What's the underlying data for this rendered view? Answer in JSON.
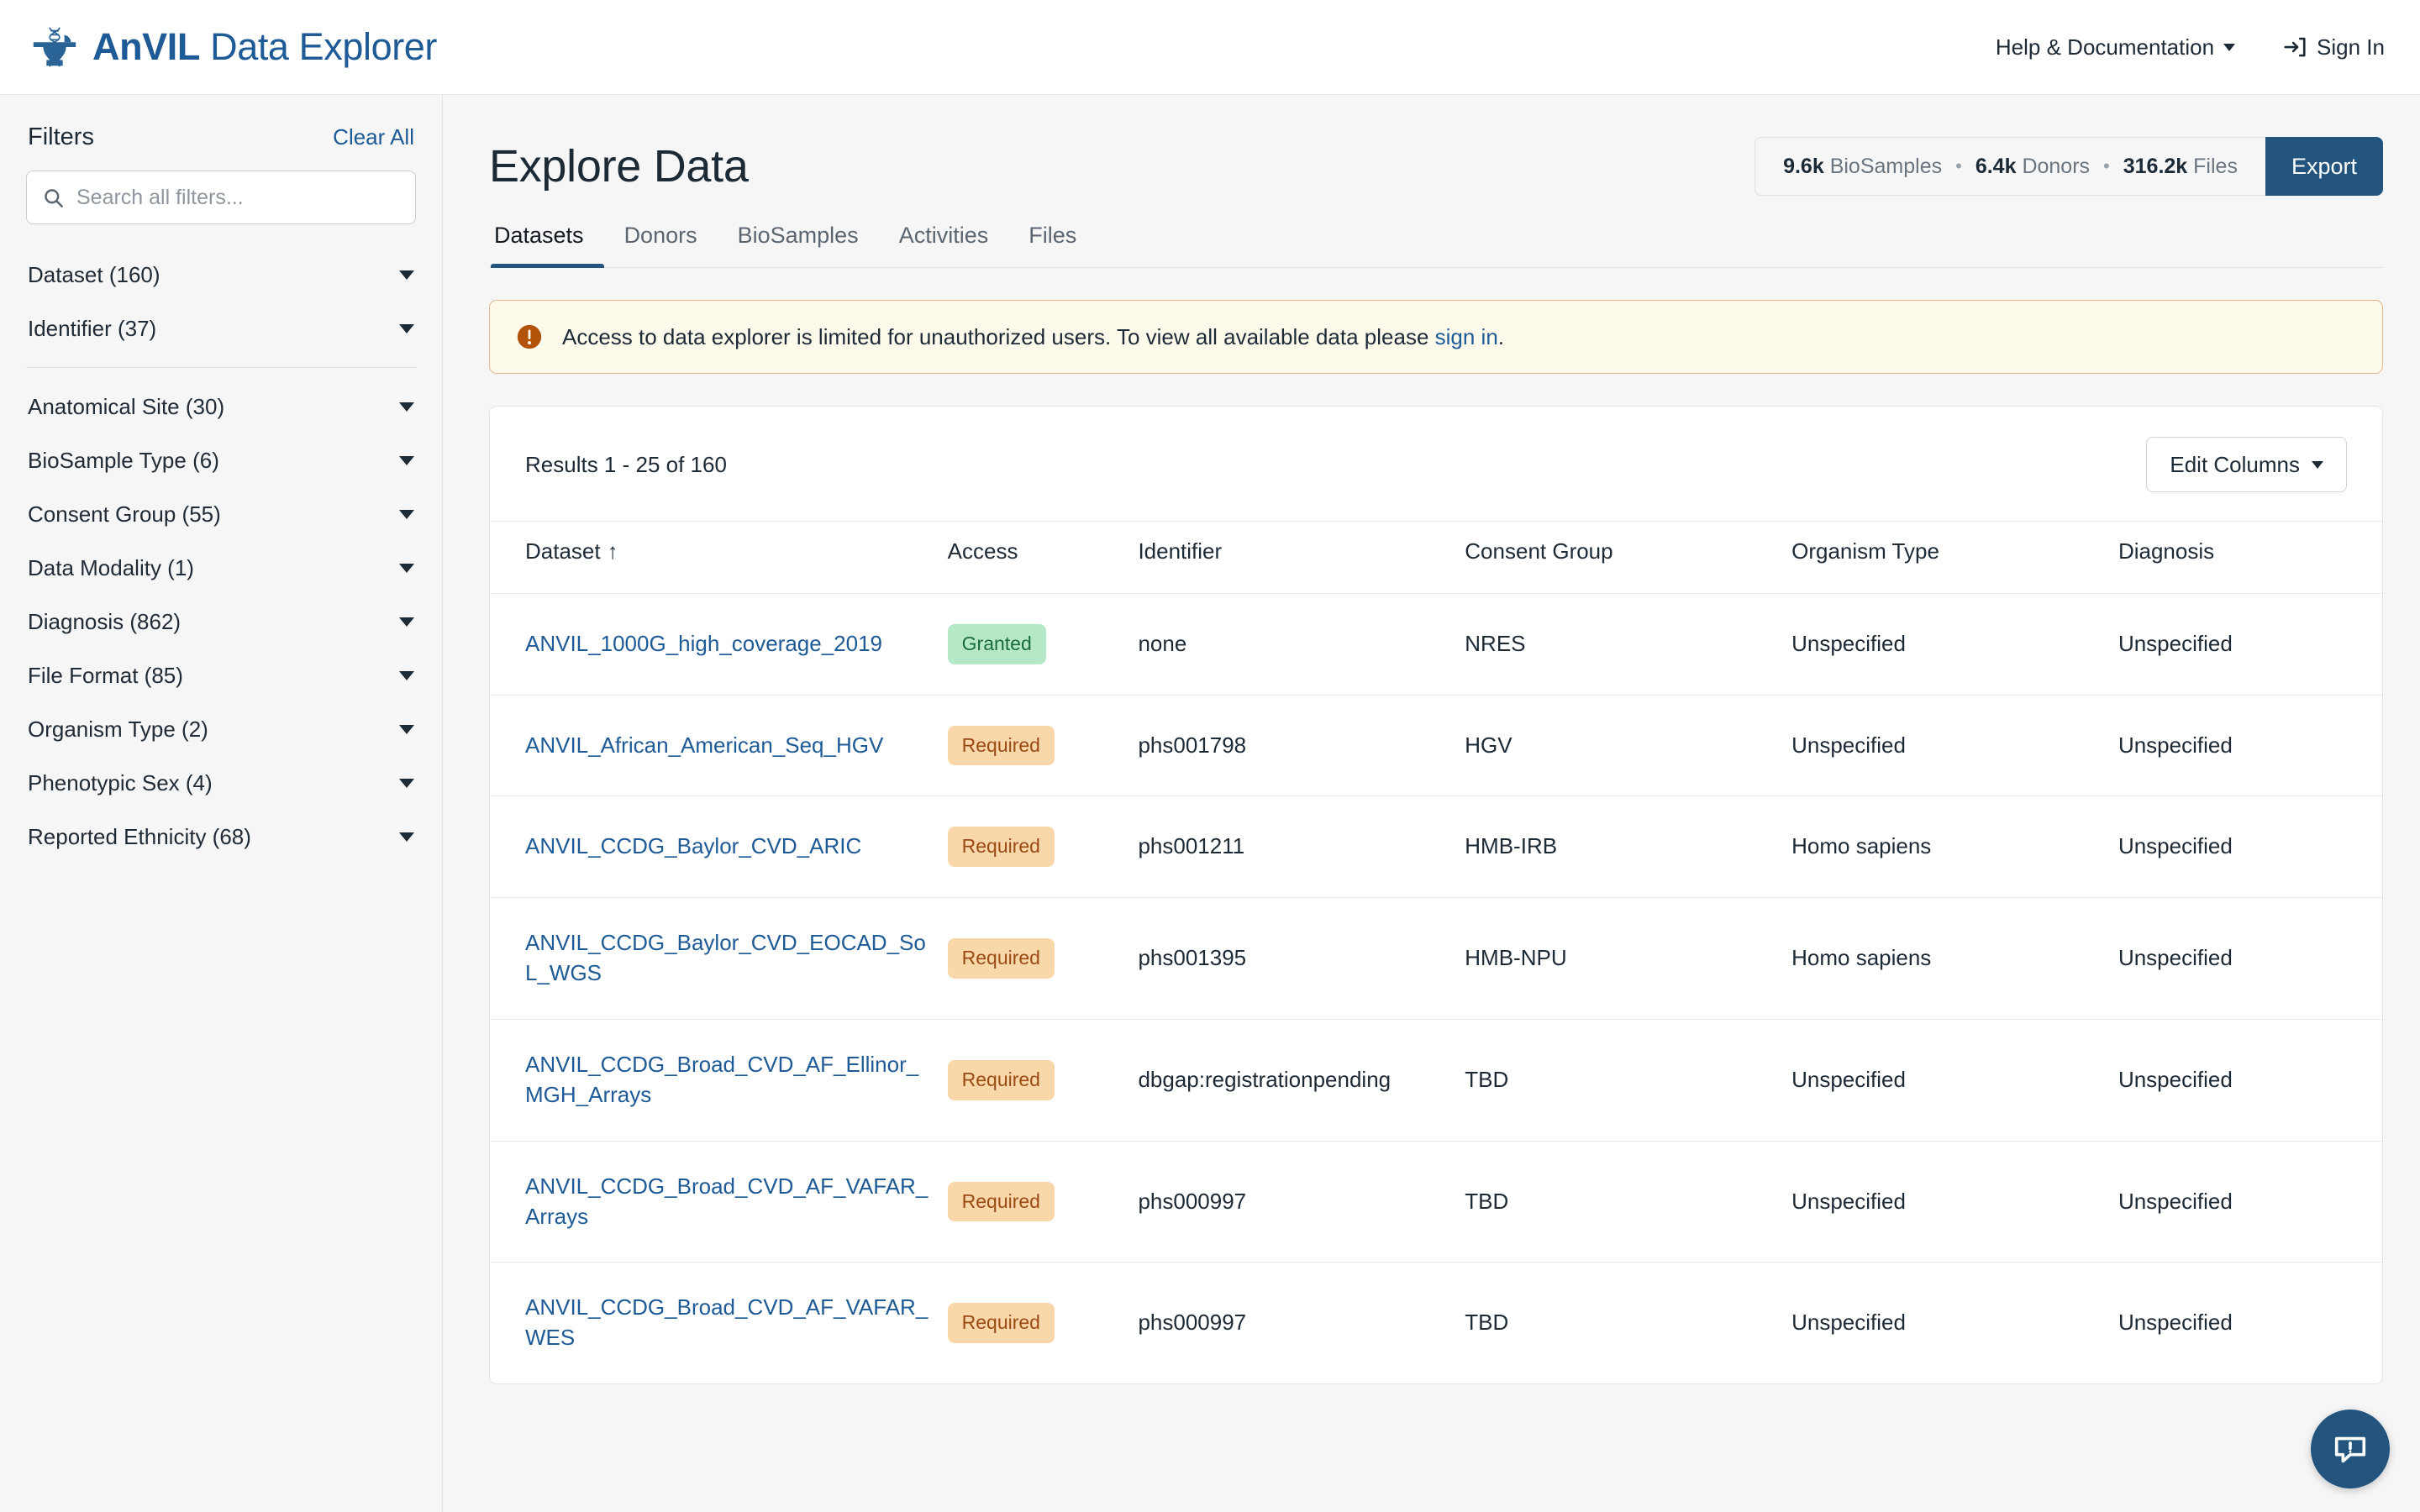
{
  "header": {
    "brand_bold": "AnVIL",
    "brand_light": " Data Explorer",
    "help_label": "Help & Documentation",
    "signin_label": "Sign In"
  },
  "sidebar": {
    "title": "Filters",
    "clear_all": "Clear All",
    "search_placeholder": "Search all filters...",
    "search_value": "",
    "group_a": [
      {
        "label": "Dataset (160)"
      },
      {
        "label": "Identifier (37)"
      }
    ],
    "group_b": [
      {
        "label": "Anatomical Site (30)"
      },
      {
        "label": "BioSample Type (6)"
      },
      {
        "label": "Consent Group (55)"
      },
      {
        "label": "Data Modality (1)"
      },
      {
        "label": "Diagnosis (862)"
      },
      {
        "label": "File Format (85)"
      },
      {
        "label": "Organism Type (2)"
      },
      {
        "label": "Phenotypic Sex (4)"
      },
      {
        "label": "Reported Ethnicity (68)"
      }
    ]
  },
  "main": {
    "page_title": "Explore Data",
    "summary": {
      "biosamples_count": "9.6k",
      "biosamples_label": "BioSamples",
      "donors_count": "6.4k",
      "donors_label": "Donors",
      "files_count": "316.2k",
      "files_label": "Files",
      "separator": "•"
    },
    "export_label": "Export",
    "tabs": [
      {
        "label": "Datasets",
        "active": true
      },
      {
        "label": "Donors",
        "active": false
      },
      {
        "label": "BioSamples",
        "active": false
      },
      {
        "label": "Activities",
        "active": false
      },
      {
        "label": "Files",
        "active": false
      }
    ],
    "alert": {
      "text": "Access to data explorer is limited for unauthorized users. To view all available data please ",
      "link_text": "sign in",
      "tail": "."
    },
    "results_text": "Results 1 - 25 of 160",
    "edit_columns_label": "Edit Columns",
    "columns": [
      {
        "label": "Dataset",
        "sort": "↑"
      },
      {
        "label": "Access",
        "sort": ""
      },
      {
        "label": "Identifier",
        "sort": ""
      },
      {
        "label": "Consent Group",
        "sort": ""
      },
      {
        "label": "Organism Type",
        "sort": ""
      },
      {
        "label": "Diagnosis",
        "sort": ""
      }
    ],
    "rows": [
      {
        "dataset": "ANVIL_1000G_high_coverage_2019",
        "access": "Granted",
        "access_state": "granted",
        "identifier": "none",
        "consent_group": "NRES",
        "organism_type": "Unspecified",
        "diagnosis": "Unspecified"
      },
      {
        "dataset": "ANVIL_African_American_Seq_HGV",
        "access": "Required",
        "access_state": "required",
        "identifier": "phs001798",
        "consent_group": "HGV",
        "organism_type": "Unspecified",
        "diagnosis": "Unspecified"
      },
      {
        "dataset": "ANVIL_CCDG_Baylor_CVD_ARIC",
        "access": "Required",
        "access_state": "required",
        "identifier": "phs001211",
        "consent_group": "HMB-IRB",
        "organism_type": "Homo sapiens",
        "diagnosis": "Unspecified"
      },
      {
        "dataset": "ANVIL_CCDG_Baylor_CVD_EOCAD_SoL_WGS",
        "access": "Required",
        "access_state": "required",
        "identifier": "phs001395",
        "consent_group": "HMB-NPU",
        "organism_type": "Homo sapiens",
        "diagnosis": "Unspecified"
      },
      {
        "dataset": "ANVIL_CCDG_Broad_CVD_AF_Ellinor_MGH_Arrays",
        "access": "Required",
        "access_state": "required",
        "identifier": "dbgap:registrationpending",
        "consent_group": "TBD",
        "organism_type": "Unspecified",
        "diagnosis": "Unspecified"
      },
      {
        "dataset": "ANVIL_CCDG_Broad_CVD_AF_VAFAR_Arrays",
        "access": "Required",
        "access_state": "required",
        "identifier": "phs000997",
        "consent_group": "TBD",
        "organism_type": "Unspecified",
        "diagnosis": "Unspecified"
      },
      {
        "dataset": "ANVIL_CCDG_Broad_CVD_AF_VAFAR_WES",
        "access": "Required",
        "access_state": "required",
        "identifier": "phs000997",
        "consent_group": "TBD",
        "organism_type": "Unspecified",
        "diagnosis": "Unspecified"
      }
    ]
  },
  "colors": {
    "brand": "#1d5a96",
    "accent": "#22547e",
    "granted_bg": "#b5e8c7",
    "granted_fg": "#1d6b3c",
    "required_bg": "#f8d7a8",
    "required_fg": "#9b4a16",
    "alert_bg": "#fdfaec",
    "alert_border": "#e6b88c",
    "alert_icon": "#b35309"
  },
  "fab": {
    "name": "feedback-button"
  }
}
